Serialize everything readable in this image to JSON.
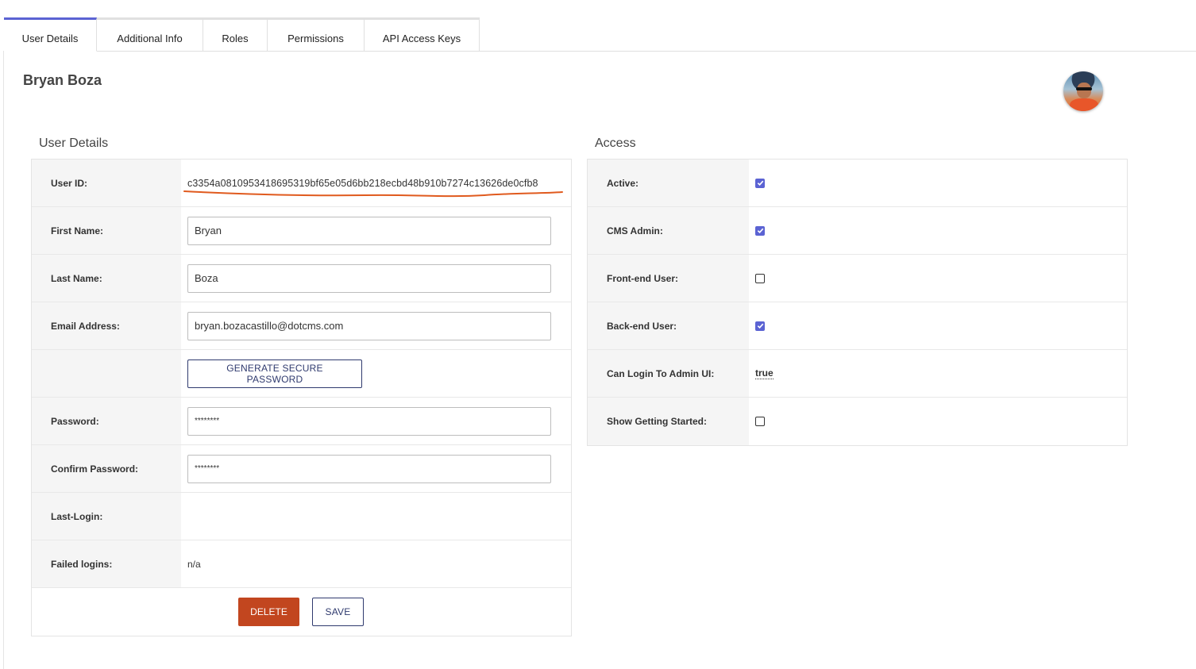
{
  "tabs": [
    {
      "label": "User Details",
      "active": true
    },
    {
      "label": "Additional Info",
      "active": false
    },
    {
      "label": "Roles",
      "active": false
    },
    {
      "label": "Permissions",
      "active": false
    },
    {
      "label": "API Access Keys",
      "active": false
    }
  ],
  "user": {
    "display_name": "Bryan Boza"
  },
  "details": {
    "title": "User Details",
    "user_id_label": "User ID:",
    "user_id": "c3354a0810953418695319bf65e05d6bb218ecbd48b910b7274c13626de0cfb8",
    "first_name_label": "First Name:",
    "first_name": "Bryan",
    "last_name_label": "Last Name:",
    "last_name": "Boza",
    "email_label": "Email Address:",
    "email": "bryan.bozacastillo@dotcms.com",
    "generate_password_label": "GENERATE SECURE PASSWORD",
    "password_label": "Password:",
    "password": "********",
    "confirm_password_label": "Confirm Password:",
    "confirm_password": "********",
    "last_login_label": "Last-Login:",
    "last_login": "",
    "failed_logins_label": "Failed logins:",
    "failed_logins": "n/a",
    "delete_label": "DELETE",
    "save_label": "SAVE"
  },
  "access": {
    "title": "Access",
    "active_label": "Active:",
    "active": true,
    "cms_admin_label": "CMS Admin:",
    "cms_admin": true,
    "frontend_label": "Front-end User:",
    "frontend": false,
    "backend_label": "Back-end User:",
    "backend": true,
    "can_login_label": "Can Login To Admin UI:",
    "can_login": "true",
    "getting_started_label": "Show Getting Started:",
    "getting_started": false
  },
  "colors": {
    "accent": "#5b63d3",
    "danger": "#c2461f",
    "annotation": "#e05a1e"
  }
}
